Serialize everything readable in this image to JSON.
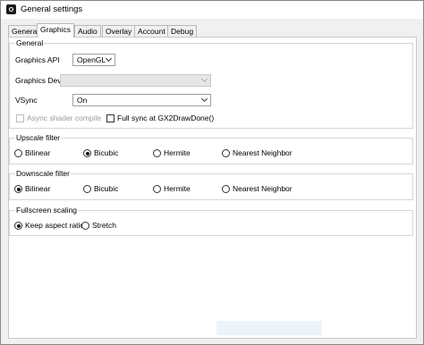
{
  "window": {
    "title": "General settings",
    "icon": "gear-icon"
  },
  "tabs": [
    "General",
    "Graphics",
    "Audio",
    "Overlay",
    "Account",
    "Debug"
  ],
  "active_tab": "Graphics",
  "general": {
    "label": "General",
    "graphics_api": {
      "label": "Graphics API",
      "value": "OpenGL"
    },
    "graphics_device": {
      "label": "Graphics Device",
      "value": ""
    },
    "vsync": {
      "label": "VSync",
      "value": "On"
    },
    "async_shader": {
      "label": "Async shader compile",
      "checked": false,
      "disabled": true
    },
    "full_sync": {
      "label": "Full sync at GX2DrawDone()",
      "checked": false
    }
  },
  "upscale": {
    "label": "Upscale filter",
    "options": [
      "Bilinear",
      "Bicubic",
      "Hermite",
      "Nearest Neighbor"
    ],
    "selected": "Bicubic"
  },
  "downscale": {
    "label": "Downscale filter",
    "options": [
      "Bilinear",
      "Bicubic",
      "Hermite",
      "Nearest Neighbor"
    ],
    "selected": "Bilinear"
  },
  "fullscreen": {
    "label": "Fullscreen scaling",
    "options": [
      "Keep aspect ratio",
      "Stretch"
    ],
    "selected": "Keep aspect ratio"
  }
}
